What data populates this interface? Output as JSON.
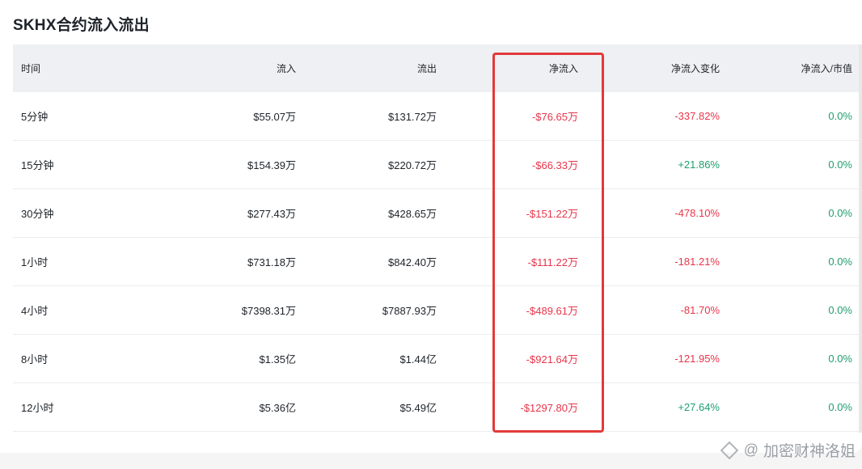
{
  "title": "SKHX合约流入流出",
  "table": {
    "headers": [
      "时间",
      "流入",
      "流出",
      "净流入",
      "净流入变化",
      "净流入/市值"
    ],
    "rows": [
      {
        "time": "5分钟",
        "inflow": "$55.07万",
        "outflow": "$131.72万",
        "net": "-$76.65万",
        "change": "-337.82%",
        "ratio": "0.0%"
      },
      {
        "time": "15分钟",
        "inflow": "$154.39万",
        "outflow": "$220.72万",
        "net": "-$66.33万",
        "change": "+21.86%",
        "ratio": "0.0%"
      },
      {
        "time": "30分钟",
        "inflow": "$277.43万",
        "outflow": "$428.65万",
        "net": "-$151.22万",
        "change": "-478.10%",
        "ratio": "0.0%"
      },
      {
        "time": "1小时",
        "inflow": "$731.18万",
        "outflow": "$842.40万",
        "net": "-$111.22万",
        "change": "-181.21%",
        "ratio": "0.0%"
      },
      {
        "time": "4小时",
        "inflow": "$7398.31万",
        "outflow": "$7887.93万",
        "net": "-$489.61万",
        "change": "-81.70%",
        "ratio": "0.0%"
      },
      {
        "time": "8小时",
        "inflow": "$1.35亿",
        "outflow": "$1.44亿",
        "net": "-$921.64万",
        "change": "-121.95%",
        "ratio": "0.0%"
      },
      {
        "time": "12小时",
        "inflow": "$5.36亿",
        "outflow": "$5.49亿",
        "net": "-$1297.80万",
        "change": "+27.64%",
        "ratio": "0.0%"
      }
    ]
  },
  "watermark": {
    "at": "@",
    "text": "加密财神洛姐"
  },
  "colors": {
    "negative": "#e8354a",
    "positive": "#1f9e6f",
    "highlight_border": "#e33a3a",
    "header_bg": "#eef0f3"
  }
}
